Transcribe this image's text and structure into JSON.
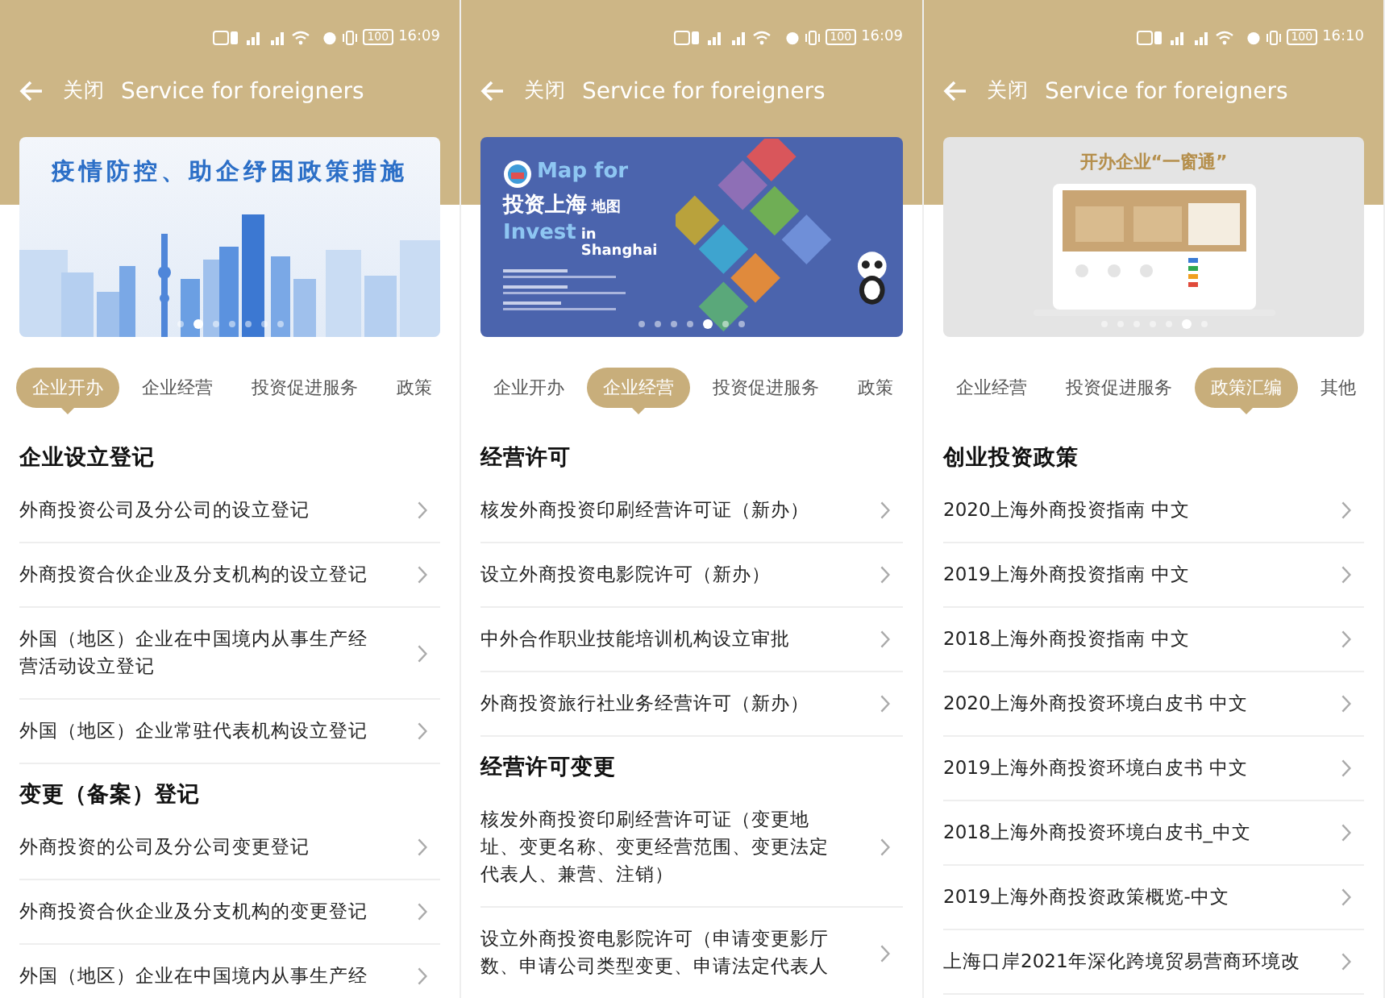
{
  "panels": [
    {
      "status": {
        "battery": "100",
        "time": "16:09"
      },
      "header": {
        "close": "关闭",
        "title": "Service for foreigners"
      },
      "banner": {
        "kind": "skyline",
        "texts": [
          "疫情防控、助企纾困政策措施"
        ],
        "dots": [
          {
            "selected": false
          },
          {
            "selected": true
          },
          {
            "selected": false
          },
          {
            "selected": false
          },
          {
            "selected": false
          },
          {
            "selected": false
          },
          {
            "selected": false
          }
        ]
      },
      "tabs": [
        {
          "label": "企业开办",
          "selected": true
        },
        {
          "label": "企业经营",
          "selected": false
        },
        {
          "label": "投资促进服务",
          "selected": false
        },
        {
          "label": "政策",
          "selected": false
        }
      ],
      "sections": [
        {
          "heading": "企业设立登记",
          "items": [
            "外商投资公司及分公司的设立登记",
            "外商投资合伙企业及分支机构的设立登记",
            "外国（地区）企业在中国境内从事生产经营活动设立登记",
            "外国（地区）企业常驻代表机构设立登记"
          ]
        },
        {
          "heading": "变更（备案）登记",
          "items": [
            "外商投资的公司及分公司变更登记",
            "外商投资合伙企业及分支机构的变更登记",
            "外国（地区）企业在中国境内从事生产经"
          ]
        }
      ]
    },
    {
      "status": {
        "battery": "100",
        "time": "16:09"
      },
      "header": {
        "close": "关闭",
        "title": "Service for foreigners"
      },
      "banner": {
        "kind": "map",
        "texts": [
          "Map for",
          "投资上海",
          "地图",
          "Invest",
          "in Shanghai"
        ],
        "dots": [
          {
            "selected": false
          },
          {
            "selected": false
          },
          {
            "selected": false
          },
          {
            "selected": false
          },
          {
            "selected": true
          },
          {
            "selected": false
          },
          {
            "selected": false
          }
        ]
      },
      "tabs": [
        {
          "label": "企业开办",
          "selected": false
        },
        {
          "label": "企业经营",
          "selected": true
        },
        {
          "label": "投资促进服务",
          "selected": false
        },
        {
          "label": "政策",
          "selected": false
        }
      ],
      "sections": [
        {
          "heading": "经营许可",
          "items": [
            "核发外商投资印刷经营许可证（新办）",
            "设立外商投资电影院许可（新办）",
            "中外合作职业技能培训机构设立审批",
            "外商投资旅行社业务经营许可（新办）"
          ]
        },
        {
          "heading": "经营许可变更",
          "items": [
            "核发外商投资印刷经营许可证（变更地址、变更名称、变更经营范围、变更法定代表人、兼营、注销）",
            "设立外商投资电影院许可（申请变更影厅数、申请公司类型变更、申请法定代表人"
          ]
        }
      ]
    },
    {
      "status": {
        "battery": "100",
        "time": "16:10"
      },
      "header": {
        "close": "关闭",
        "title": "Service for foreigners"
      },
      "banner": {
        "kind": "laptop",
        "texts": [
          "开办企业“一窗通”"
        ],
        "dots": [
          {
            "selected": false
          },
          {
            "selected": false
          },
          {
            "selected": false
          },
          {
            "selected": false
          },
          {
            "selected": false
          },
          {
            "selected": true
          },
          {
            "selected": false
          }
        ]
      },
      "tabs": [
        {
          "label": "企业经营",
          "selected": false
        },
        {
          "label": "投资促进服务",
          "selected": false
        },
        {
          "label": "政策汇编",
          "selected": true
        },
        {
          "label": "其他",
          "selected": false
        }
      ],
      "sections": [
        {
          "heading": "创业投资政策",
          "items": [
            "2020上海外商投资指南 中文",
            "2019上海外商投资指南 中文",
            "2018上海外商投资指南 中文",
            "2020上海外商投资环境白皮书 中文",
            "2019上海外商投资环境白皮书 中文",
            "2018上海外商投资环境白皮书_中文",
            "2019上海外商投资政策概览-中文",
            "上海口岸2021年深化跨境贸易营商环境改"
          ]
        }
      ]
    }
  ]
}
